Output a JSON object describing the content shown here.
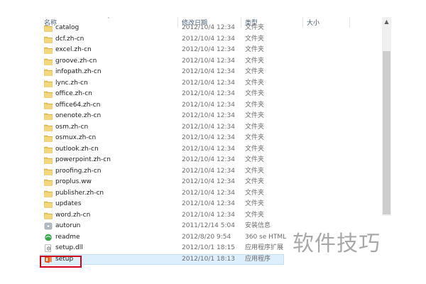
{
  "columns": {
    "name": "名称",
    "date": "修改日期",
    "type": "类型",
    "size": "大小"
  },
  "watermark": "软件技巧",
  "files": [
    {
      "name": "catalog",
      "date": "2012/10/4 12:34",
      "type": "文件夹",
      "icon": "folder-icon"
    },
    {
      "name": "dcf.zh-cn",
      "date": "2012/10/4 12:34",
      "type": "文件夹",
      "icon": "folder-icon"
    },
    {
      "name": "excel.zh-cn",
      "date": "2012/10/4 12:34",
      "type": "文件夹",
      "icon": "folder-icon"
    },
    {
      "name": "groove.zh-cn",
      "date": "2012/10/4 12:34",
      "type": "文件夹",
      "icon": "folder-icon"
    },
    {
      "name": "infopath.zh-cn",
      "date": "2012/10/4 12:34",
      "type": "文件夹",
      "icon": "folder-icon"
    },
    {
      "name": "lync.zh-cn",
      "date": "2012/10/4 12:34",
      "type": "文件夹",
      "icon": "folder-icon"
    },
    {
      "name": "office.zh-cn",
      "date": "2012/10/4 12:34",
      "type": "文件夹",
      "icon": "folder-icon"
    },
    {
      "name": "office64.zh-cn",
      "date": "2012/10/4 12:34",
      "type": "文件夹",
      "icon": "folder-icon"
    },
    {
      "name": "onenote.zh-cn",
      "date": "2012/10/4 12:34",
      "type": "文件夹",
      "icon": "folder-icon"
    },
    {
      "name": "osm.zh-cn",
      "date": "2012/10/4 12:34",
      "type": "文件夹",
      "icon": "folder-icon"
    },
    {
      "name": "osmux.zh-cn",
      "date": "2012/10/4 12:34",
      "type": "文件夹",
      "icon": "folder-icon"
    },
    {
      "name": "outlook.zh-cn",
      "date": "2012/10/4 12:34",
      "type": "文件夹",
      "icon": "folder-icon"
    },
    {
      "name": "powerpoint.zh-cn",
      "date": "2012/10/4 12:34",
      "type": "文件夹",
      "icon": "folder-icon"
    },
    {
      "name": "proofing.zh-cn",
      "date": "2012/10/4 12:34",
      "type": "文件夹",
      "icon": "folder-icon"
    },
    {
      "name": "proplus.ww",
      "date": "2012/10/4 12:34",
      "type": "文件夹",
      "icon": "folder-icon"
    },
    {
      "name": "publisher.zh-cn",
      "date": "2012/10/4 12:34",
      "type": "文件夹",
      "icon": "folder-icon"
    },
    {
      "name": "updates",
      "date": "2012/10/4 12:34",
      "type": "文件夹",
      "icon": "folder-icon"
    },
    {
      "name": "word.zh-cn",
      "date": "2012/10/4 12:34",
      "type": "文件夹",
      "icon": "folder-icon"
    },
    {
      "name": "autorun",
      "date": "2011/12/14 5:04",
      "type": "安装信息",
      "icon": "setup-info-icon"
    },
    {
      "name": "readme",
      "date": "2012/8/20 9:54",
      "type": "360 se HTML",
      "icon": "browser-html-icon"
    },
    {
      "name": "setup.dll",
      "date": "2012/10/1 18:15",
      "type": "应用程序扩展",
      "icon": "dll-gear-icon"
    },
    {
      "name": "setup",
      "date": "2012/10/1 18:13",
      "type": "应用程序",
      "icon": "office-setup-icon",
      "selected": true
    }
  ],
  "colors": {
    "accent_highlight": "#d0021b",
    "selection_bg": "#ddeefd",
    "folder": "#e8c45a"
  }
}
